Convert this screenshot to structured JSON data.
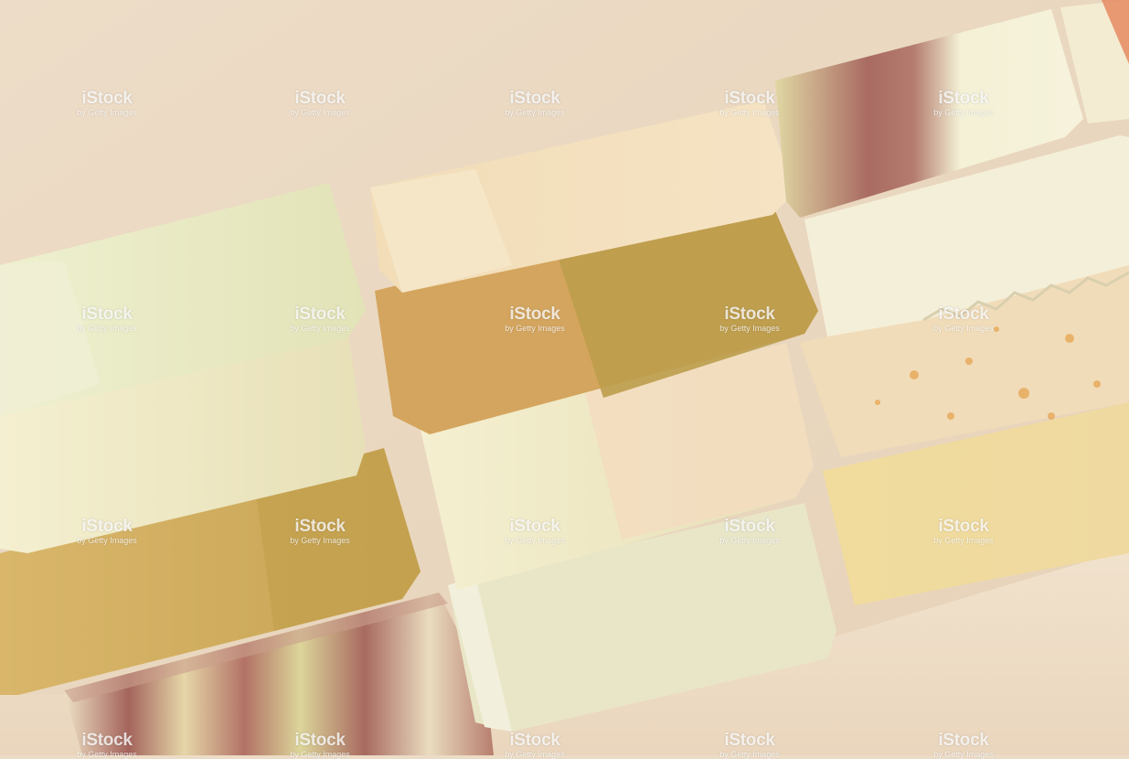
{
  "image": {
    "watermark": {
      "brand": "iStock",
      "credit": "by Getty Images"
    },
    "colors": {
      "background": "#ecdcc6",
      "table_surface": "#efdfca",
      "soap_cream": "#efe9c2",
      "soap_olive": "#c7a24e",
      "soap_mustard": "#d9a862",
      "soap_rose_swirl": "#a86c63",
      "soap_orange_speckle": "#e8a858"
    }
  }
}
